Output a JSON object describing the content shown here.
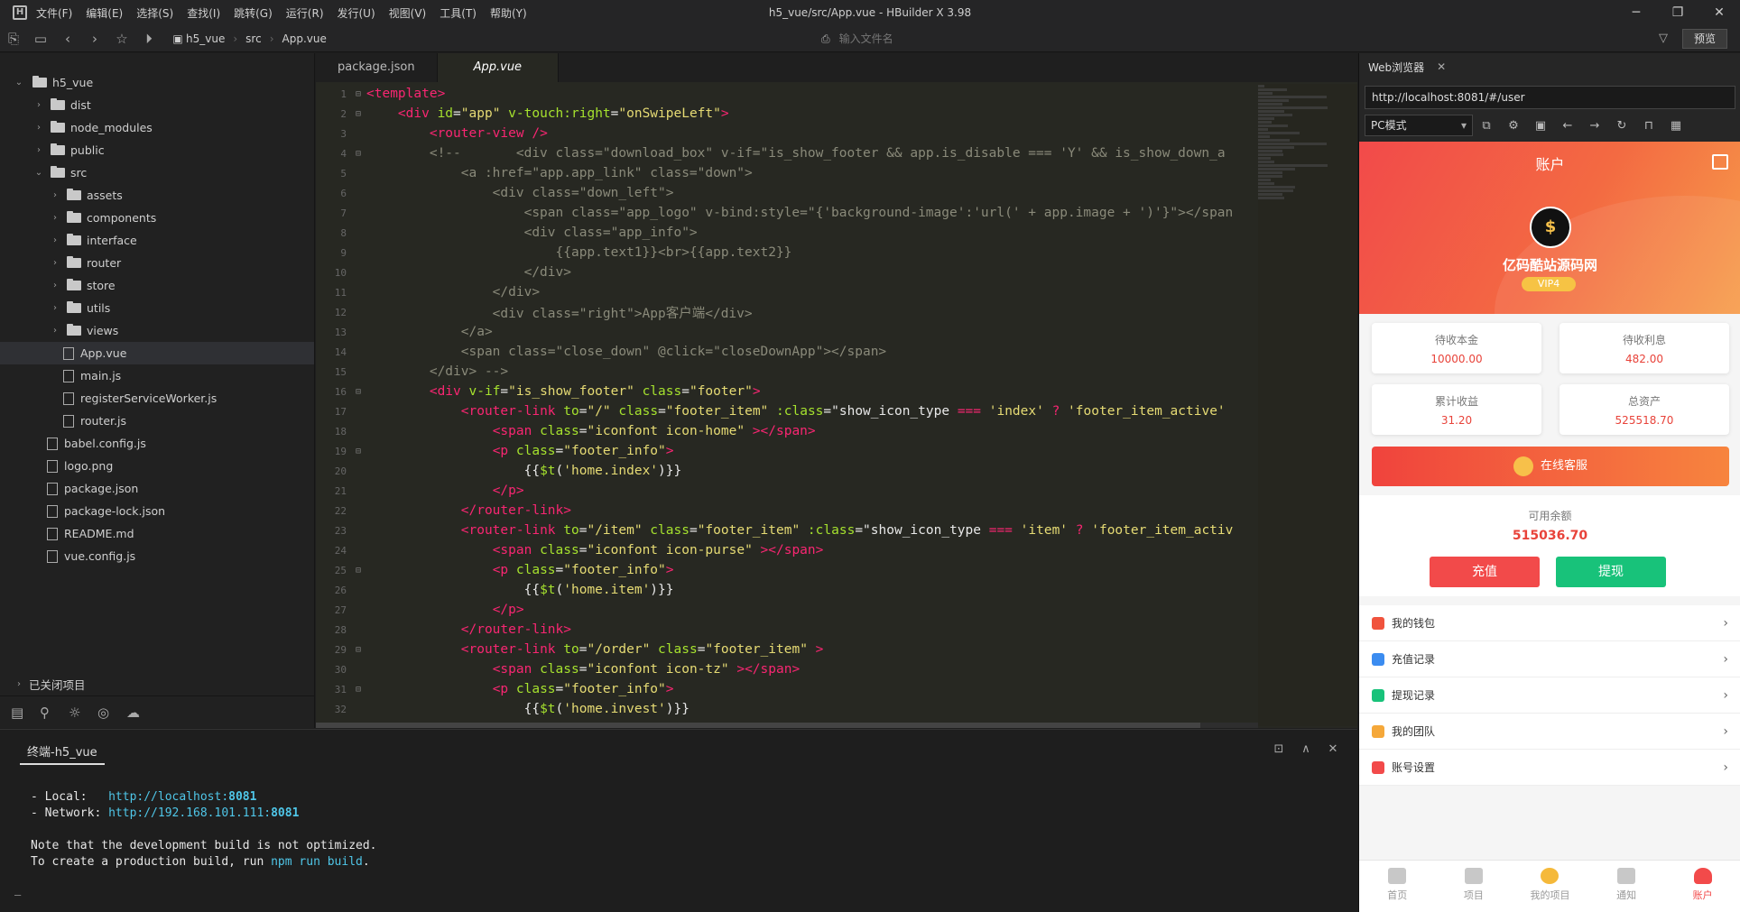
{
  "window": {
    "title": "h5_vue/src/App.vue - HBuilder X 3.98",
    "menu": [
      "文件(F)",
      "编辑(E)",
      "选择(S)",
      "查找(I)",
      "跳转(G)",
      "运行(R)",
      "发行(U)",
      "视图(V)",
      "工具(T)",
      "帮助(Y)"
    ]
  },
  "toolbar": {
    "breadcrumb": [
      "h5_vue",
      "src",
      "App.vue"
    ],
    "file_search_placeholder": "输入文件名",
    "preview_label": "预览"
  },
  "sidebar": {
    "project": "h5_vue",
    "items": [
      {
        "label": "dist",
        "type": "folder",
        "level": 1
      },
      {
        "label": "node_modules",
        "type": "folder",
        "level": 1
      },
      {
        "label": "public",
        "type": "folder",
        "level": 1
      },
      {
        "label": "src",
        "type": "folder",
        "level": 1,
        "open": true
      },
      {
        "label": "assets",
        "type": "folder",
        "level": 2
      },
      {
        "label": "components",
        "type": "folder",
        "level": 2
      },
      {
        "label": "interface",
        "type": "folder",
        "level": 2
      },
      {
        "label": "router",
        "type": "folder",
        "level": 2
      },
      {
        "label": "store",
        "type": "folder",
        "level": 2
      },
      {
        "label": "utils",
        "type": "folder",
        "level": 2
      },
      {
        "label": "views",
        "type": "folder",
        "level": 2
      },
      {
        "label": "App.vue",
        "type": "file",
        "level": 2,
        "active": true
      },
      {
        "label": "main.js",
        "type": "file",
        "level": 2
      },
      {
        "label": "registerServiceWorker.js",
        "type": "file",
        "level": 2
      },
      {
        "label": "router.js",
        "type": "file",
        "level": 2
      },
      {
        "label": "babel.config.js",
        "type": "file",
        "level": 1
      },
      {
        "label": "logo.png",
        "type": "file",
        "level": 1
      },
      {
        "label": "package.json",
        "type": "file",
        "level": 1
      },
      {
        "label": "package-lock.json",
        "type": "file",
        "level": 1
      },
      {
        "label": "README.md",
        "type": "file",
        "level": 1
      },
      {
        "label": "vue.config.js",
        "type": "file",
        "level": 1
      }
    ],
    "closed_projects": "已关闭项目"
  },
  "editor": {
    "tabs": [
      "package.json",
      "App.vue"
    ],
    "active_tab": "App.vue"
  },
  "terminal": {
    "tab": "终端-h5_vue",
    "local_label": "- Local:   ",
    "local_url": "http://localhost:",
    "local_port": "8081",
    "network_label": "- Network: ",
    "network_url": "http://192.168.101.111:",
    "network_port": "8081",
    "note1": "Note that the development build is not optimized.",
    "note2_a": "To create a production build, run ",
    "note2_cmd": "npm run build",
    "note2_b": "."
  },
  "browser": {
    "tab": "Web浏览器",
    "url": "http://localhost:8081/#/user",
    "mode": "PC模式",
    "app": {
      "title": "账户",
      "username": "亿码酷站源码网",
      "vip": "VIP4",
      "stats": [
        {
          "label": "待收本金",
          "value": "10000.00"
        },
        {
          "label": "待收利息",
          "value": "482.00"
        },
        {
          "label": "累计收益",
          "value": "31.20"
        },
        {
          "label": "总资产",
          "value": "525518.70"
        }
      ],
      "service": "在线客服",
      "balance_label": "可用余额",
      "balance_value": "515036.70",
      "recharge": "充值",
      "withdraw": "提现",
      "menu": [
        "我的钱包",
        "充值记录",
        "提现记录",
        "我的团队",
        "账号设置"
      ],
      "menu_colors": [
        "#f0533d",
        "#3b8cf0",
        "#18c27a",
        "#f5a83a",
        "#f24a4a"
      ],
      "tabbar": [
        "首页",
        "项目",
        "我的项目",
        "通知",
        "账户"
      ]
    }
  },
  "code_lines": [
    [
      [
        "tg",
        "<template>"
      ]
    ],
    [
      [
        "txt",
        "    "
      ],
      [
        "tg",
        "<div "
      ],
      [
        "at",
        "id"
      ],
      [
        "txt",
        "="
      ],
      [
        "st",
        "\"app\""
      ],
      [
        "at",
        " v-touch:right"
      ],
      [
        "txt",
        "="
      ],
      [
        "st",
        "\"onSwipeLeft\""
      ],
      [
        "tg",
        ">"
      ]
    ],
    [
      [
        "txt",
        "        "
      ],
      [
        "tg",
        "<router-view "
      ],
      [
        "tg",
        "/>"
      ]
    ],
    [
      [
        "txt",
        "        "
      ],
      [
        "cm",
        "<!--       <div class=\"download_box\" v-if=\"is_show_footer && app.is_disable === 'Y' && is_show_down_a"
      ]
    ],
    [
      [
        "cm",
        "            <a :href=\"app.app_link\" class=\"down\">"
      ]
    ],
    [
      [
        "cm",
        "                <div class=\"down_left\">"
      ]
    ],
    [
      [
        "cm",
        "                    <span class=\"app_logo\" v-bind:style=\"{'background-image':'url(' + app.image + ')'}\"></span"
      ]
    ],
    [
      [
        "cm",
        "                    <div class=\"app_info\">"
      ]
    ],
    [
      [
        "cm",
        "                        {{app.text1}}<br>{{app.text2}}"
      ]
    ],
    [
      [
        "cm",
        "                    </div>"
      ]
    ],
    [
      [
        "cm",
        "                </div>"
      ]
    ],
    [
      [
        "cm",
        "                <div class=\"right\">App客户端</div>"
      ]
    ],
    [
      [
        "cm",
        "            </a>"
      ]
    ],
    [
      [
        "cm",
        "            <span class=\"close_down\" @click=\"closeDownApp\"></span>"
      ]
    ],
    [
      [
        "cm",
        "        </div> -->"
      ]
    ],
    [
      [
        "txt",
        "        "
      ],
      [
        "tg",
        "<div "
      ],
      [
        "at",
        "v-if"
      ],
      [
        "txt",
        "="
      ],
      [
        "st",
        "\"is_show_footer\""
      ],
      [
        "at",
        " class"
      ],
      [
        "txt",
        "="
      ],
      [
        "st",
        "\"footer\""
      ],
      [
        "tg",
        ">"
      ]
    ],
    [
      [
        "txt",
        "            "
      ],
      [
        "tg",
        "<router-link "
      ],
      [
        "at",
        "to"
      ],
      [
        "txt",
        "="
      ],
      [
        "st",
        "\"/\""
      ],
      [
        "at",
        " class"
      ],
      [
        "txt",
        "="
      ],
      [
        "st",
        "\"footer_item\""
      ],
      [
        "at",
        " :class"
      ],
      [
        "txt",
        "=\"show_icon_type "
      ],
      [
        "op",
        "==="
      ],
      [
        "st",
        " 'index'"
      ],
      [
        "op",
        " ?"
      ],
      [
        "st",
        " 'footer_item_active'"
      ]
    ],
    [
      [
        "txt",
        "                "
      ],
      [
        "tg",
        "<span "
      ],
      [
        "at",
        "class"
      ],
      [
        "txt",
        "="
      ],
      [
        "st",
        "\"iconfont icon-home\""
      ],
      [
        "tg",
        " ></span>"
      ]
    ],
    [
      [
        "txt",
        "                "
      ],
      [
        "tg",
        "<p "
      ],
      [
        "at",
        "class"
      ],
      [
        "txt",
        "="
      ],
      [
        "st",
        "\"footer_info\""
      ],
      [
        "tg",
        ">"
      ]
    ],
    [
      [
        "txt",
        "                    {{"
      ],
      [
        "at",
        "$t"
      ],
      [
        "txt",
        "("
      ],
      [
        "st",
        "'home.index'"
      ],
      [
        "txt",
        ")}}"
      ]
    ],
    [
      [
        "txt",
        "                "
      ],
      [
        "tg",
        "</p>"
      ]
    ],
    [
      [
        "txt",
        "            "
      ],
      [
        "tg",
        "</router-link>"
      ]
    ],
    [
      [
        "txt",
        "            "
      ],
      [
        "tg",
        "<router-link "
      ],
      [
        "at",
        "to"
      ],
      [
        "txt",
        "="
      ],
      [
        "st",
        "\"/item\""
      ],
      [
        "at",
        " class"
      ],
      [
        "txt",
        "="
      ],
      [
        "st",
        "\"footer_item\""
      ],
      [
        "at",
        " :class"
      ],
      [
        "txt",
        "=\"show_icon_type "
      ],
      [
        "op",
        "==="
      ],
      [
        "st",
        " 'item'"
      ],
      [
        "op",
        " ?"
      ],
      [
        "st",
        " 'footer_item_activ"
      ]
    ],
    [
      [
        "txt",
        "                "
      ],
      [
        "tg",
        "<span "
      ],
      [
        "at",
        "class"
      ],
      [
        "txt",
        "="
      ],
      [
        "st",
        "\"iconfont icon-purse\""
      ],
      [
        "tg",
        " ></span>"
      ]
    ],
    [
      [
        "txt",
        "                "
      ],
      [
        "tg",
        "<p "
      ],
      [
        "at",
        "class"
      ],
      [
        "txt",
        "="
      ],
      [
        "st",
        "\"footer_info\""
      ],
      [
        "tg",
        ">"
      ]
    ],
    [
      [
        "txt",
        "                    {{"
      ],
      [
        "at",
        "$t"
      ],
      [
        "txt",
        "("
      ],
      [
        "st",
        "'home.item'"
      ],
      [
        "txt",
        ")}}"
      ]
    ],
    [
      [
        "txt",
        "                "
      ],
      [
        "tg",
        "</p>"
      ]
    ],
    [
      [
        "txt",
        "            "
      ],
      [
        "tg",
        "</router-link>"
      ]
    ],
    [
      [
        "txt",
        "            "
      ],
      [
        "tg",
        "<router-link "
      ],
      [
        "at",
        "to"
      ],
      [
        "txt",
        "="
      ],
      [
        "st",
        "\"/order\""
      ],
      [
        "at",
        " class"
      ],
      [
        "txt",
        "="
      ],
      [
        "st",
        "\"footer_item\""
      ],
      [
        "tg",
        " >"
      ]
    ],
    [
      [
        "txt",
        "                "
      ],
      [
        "tg",
        "<span "
      ],
      [
        "at",
        "class"
      ],
      [
        "txt",
        "="
      ],
      [
        "st",
        "\"iconfont icon-tz\""
      ],
      [
        "tg",
        " ></span>"
      ]
    ],
    [
      [
        "txt",
        "                "
      ],
      [
        "tg",
        "<p "
      ],
      [
        "at",
        "class"
      ],
      [
        "txt",
        "="
      ],
      [
        "st",
        "\"footer_info\""
      ],
      [
        "tg",
        ">"
      ]
    ],
    [
      [
        "txt",
        "                    {{"
      ],
      [
        "at",
        "$t"
      ],
      [
        "txt",
        "("
      ],
      [
        "st",
        "'home.invest'"
      ],
      [
        "txt",
        ")}}"
      ]
    ]
  ],
  "fold_lines": [
    1,
    2,
    4,
    16,
    19,
    25,
    29,
    31
  ]
}
